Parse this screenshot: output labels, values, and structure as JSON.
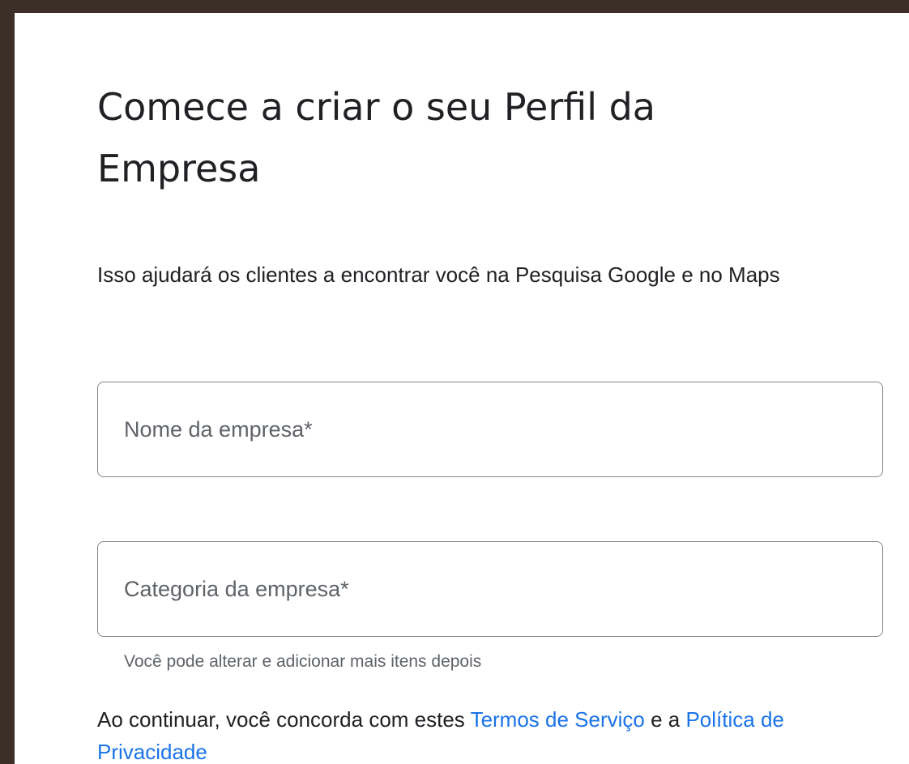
{
  "page": {
    "title": "Comece a criar o seu Perfil da Empresa",
    "subtitle": "Isso ajudará os clientes a encontrar você na Pesquisa Google e no Maps"
  },
  "form": {
    "business_name": {
      "placeholder": "Nome da empresa*",
      "value": ""
    },
    "business_category": {
      "placeholder": "Categoria da empresa*",
      "value": "",
      "helper": "Você pode alterar e adicionar mais itens depois"
    }
  },
  "terms": {
    "prefix": "Ao continuar, você concorda com estes ",
    "terms_link": "Termos de Serviço",
    "middle": " e a ",
    "privacy_link": "Política de Privacidade"
  },
  "colors": {
    "backdrop": "#3b2f27",
    "link": "#1a73e8",
    "text": "#202124",
    "muted": "#5f6368",
    "field_border": "#80868b"
  }
}
